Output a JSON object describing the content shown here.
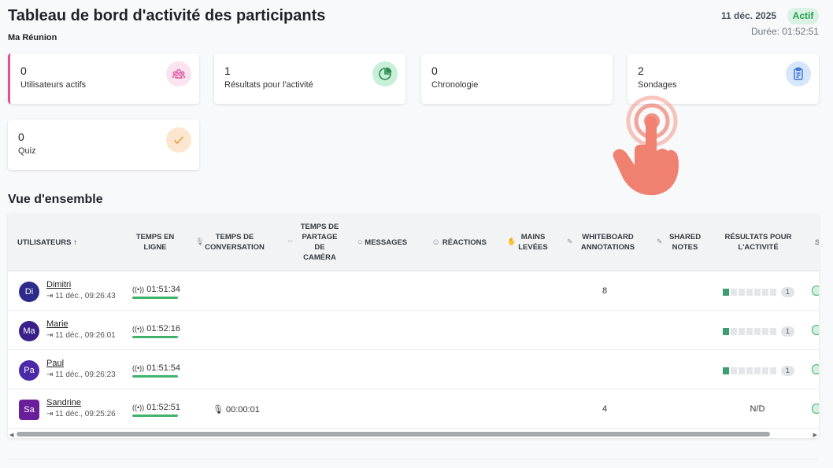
{
  "header": {
    "title": "Tableau de bord d'activité des participants",
    "meeting_name": "Ma Réunion",
    "date": "11 déc. 2025",
    "status": "Actif",
    "duration": "Durée: 01:52:51"
  },
  "cards": [
    {
      "value": "0",
      "label": "Utilisateurs actifs",
      "icon": "users-icon",
      "color": "#e0509a"
    },
    {
      "value": "1",
      "label": "Résultats pour l'activité",
      "icon": "pie-chart-icon",
      "color": "#2f9e5e"
    },
    {
      "value": "0",
      "label": "Chronologie"
    },
    {
      "value": "2",
      "label": "Sondages",
      "icon": "clipboard-icon",
      "color": "#3b6fd6"
    },
    {
      "value": "0",
      "label": "Quiz",
      "icon": "check-icon",
      "color": "#e59a3a"
    }
  ],
  "section_title": "Vue d'ensemble",
  "table": {
    "headers": {
      "users": "UTILISATEURS",
      "online_line1": "TEMPS EN",
      "online_line2": "LIGNE",
      "talk_line1": "TEMPS DE",
      "talk_line2": "CONVERSATION",
      "cam_line1": "TEMPS DE",
      "cam_line2": "PARTAGE",
      "cam_line3": "DE",
      "cam_line4": "CAMÉRA",
      "messages": "MESSAGES",
      "reactions": "RÉACTIONS",
      "hands_line1": "MAINS",
      "hands_line2": "LEVÉES",
      "wb_line1": "WHITEBOARD",
      "wb_line2": "ANNOTATIONS",
      "notes_line1": "SHARED",
      "notes_line2": "NOTES",
      "results_line1": "RÉSULTATS POUR",
      "results_line2": "L'ACTIVITÉ",
      "cut": "S"
    },
    "rows": [
      {
        "initials": "Di",
        "name": "Dimitri",
        "joined": "11 déc., 09:26:43",
        "online": "01:51:34",
        "talk": "",
        "whiteboard": "8",
        "results_filled": 1,
        "results_count": "1",
        "avatar_color": "#2e2a8c"
      },
      {
        "initials": "Ma",
        "name": "Marie",
        "joined": "11 déc., 09:26:01",
        "online": "01:52:16",
        "talk": "",
        "whiteboard": "",
        "results_filled": 1,
        "results_count": "1",
        "avatar_color": "#3a1f8a"
      },
      {
        "initials": "Pa",
        "name": "Paul",
        "joined": "11 déc., 09:26:23",
        "online": "01:51:54",
        "talk": "",
        "whiteboard": "",
        "results_filled": 1,
        "results_count": "1",
        "avatar_color": "#4a2aa6"
      },
      {
        "initials": "Sa",
        "name": "Sandrine",
        "joined": "11 déc., 09:25:26",
        "online": "01:52:51",
        "talk": "00:00:01",
        "whiteboard": "4",
        "results_text": "N/D",
        "avatar_color": "#6a1f9a"
      }
    ]
  },
  "colors": {
    "online_bar": "#3fb36b",
    "accent": "#e0509a",
    "hand_pointer": "#f08070"
  }
}
